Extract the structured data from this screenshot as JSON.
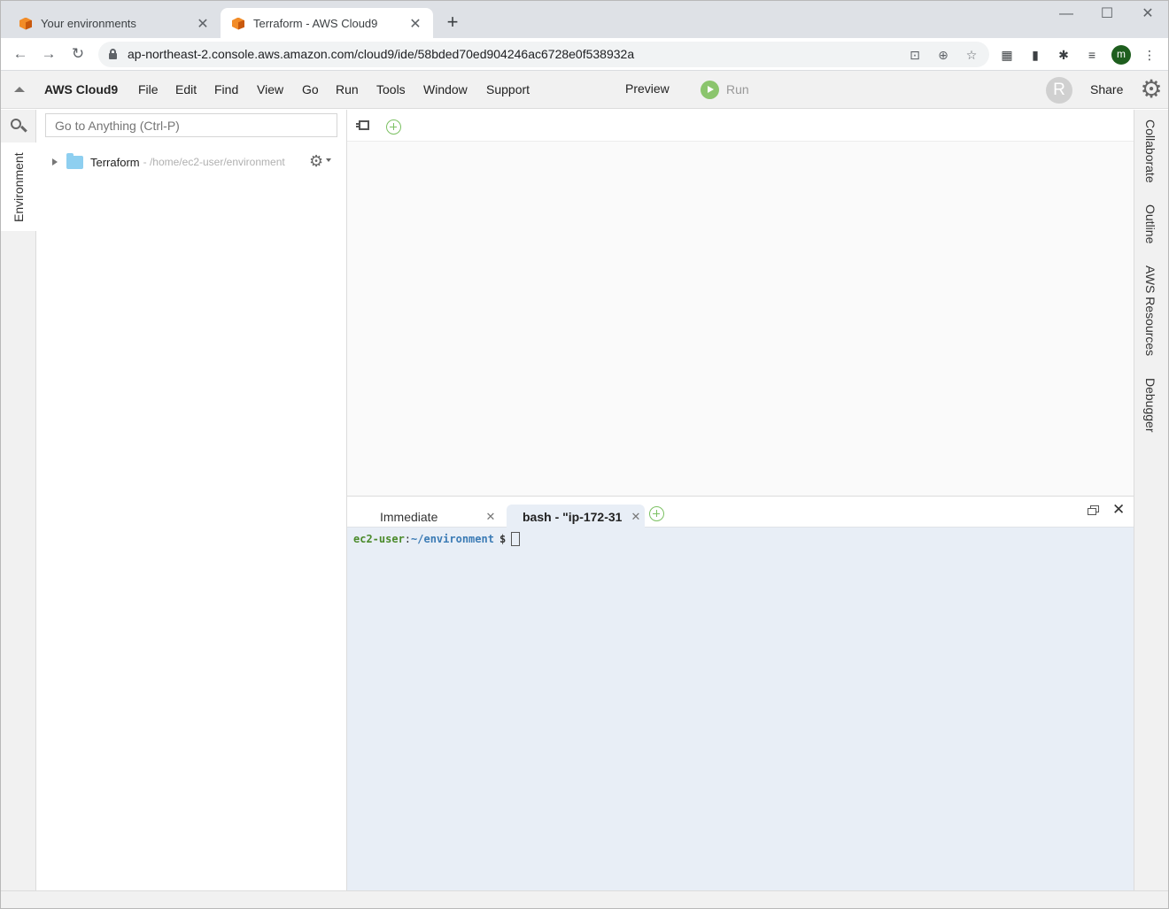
{
  "browser": {
    "tabs": [
      {
        "title": "Your environments"
      },
      {
        "title": "Terraform - AWS Cloud9"
      }
    ],
    "new_tab_label": "+",
    "url": "ap-northeast-2.console.aws.amazon.com/cloud9/ide/58bded70ed904246ac6728e0f538932a",
    "profile_initial": "m"
  },
  "menubar": {
    "brand": "AWS Cloud9",
    "items": [
      "File",
      "Edit",
      "Find",
      "View",
      "Go",
      "Run",
      "Tools",
      "Window",
      "Support"
    ],
    "preview": "Preview",
    "run": "Run",
    "avatar_initial": "R",
    "share": "Share"
  },
  "left_panel": {
    "env_tab": "Environment",
    "search_placeholder": "Go to Anything (Ctrl-P)",
    "tree": {
      "root_name": "Terraform",
      "root_path": " - /home/ec2-user/environment"
    }
  },
  "terminal": {
    "tabs": [
      {
        "label": "Immediate"
      },
      {
        "label": "bash - \"ip-172-31"
      }
    ],
    "prompt_user": "ec2-user",
    "prompt_colon": ":",
    "prompt_path": "~/environment",
    "prompt_symbol": "$"
  },
  "right_panel": {
    "tabs": [
      "Collaborate",
      "Outline",
      "AWS Resources",
      "Debugger"
    ]
  }
}
